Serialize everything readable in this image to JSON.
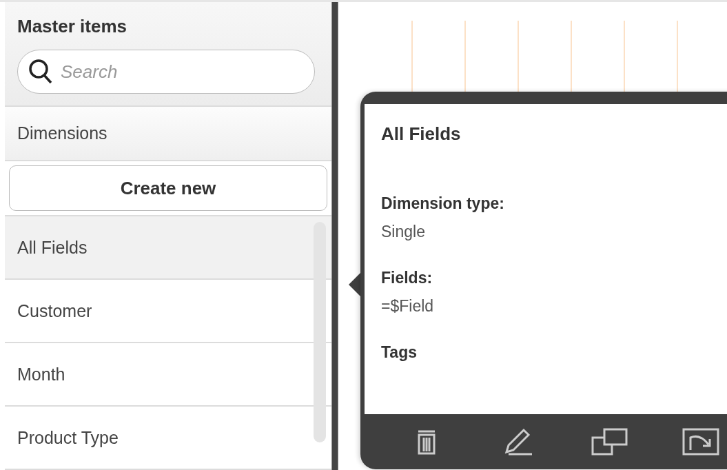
{
  "panel": {
    "title": "Master items",
    "search": {
      "placeholder": "Search"
    },
    "section": "Dimensions",
    "create_button": "Create new",
    "items": [
      {
        "label": "All Fields",
        "selected": true
      },
      {
        "label": "Customer",
        "selected": false
      },
      {
        "label": "Month",
        "selected": false
      },
      {
        "label": "Product Type",
        "selected": false
      }
    ]
  },
  "popup": {
    "title": "All Fields",
    "properties": [
      {
        "label": "Dimension type:",
        "value": "Single"
      },
      {
        "label": "Fields:",
        "value": "=$Field"
      }
    ],
    "tags_label": "Tags",
    "actions": [
      {
        "kind": "delete"
      },
      {
        "kind": "edit"
      },
      {
        "kind": "duplicate"
      },
      {
        "kind": "export"
      }
    ]
  }
}
